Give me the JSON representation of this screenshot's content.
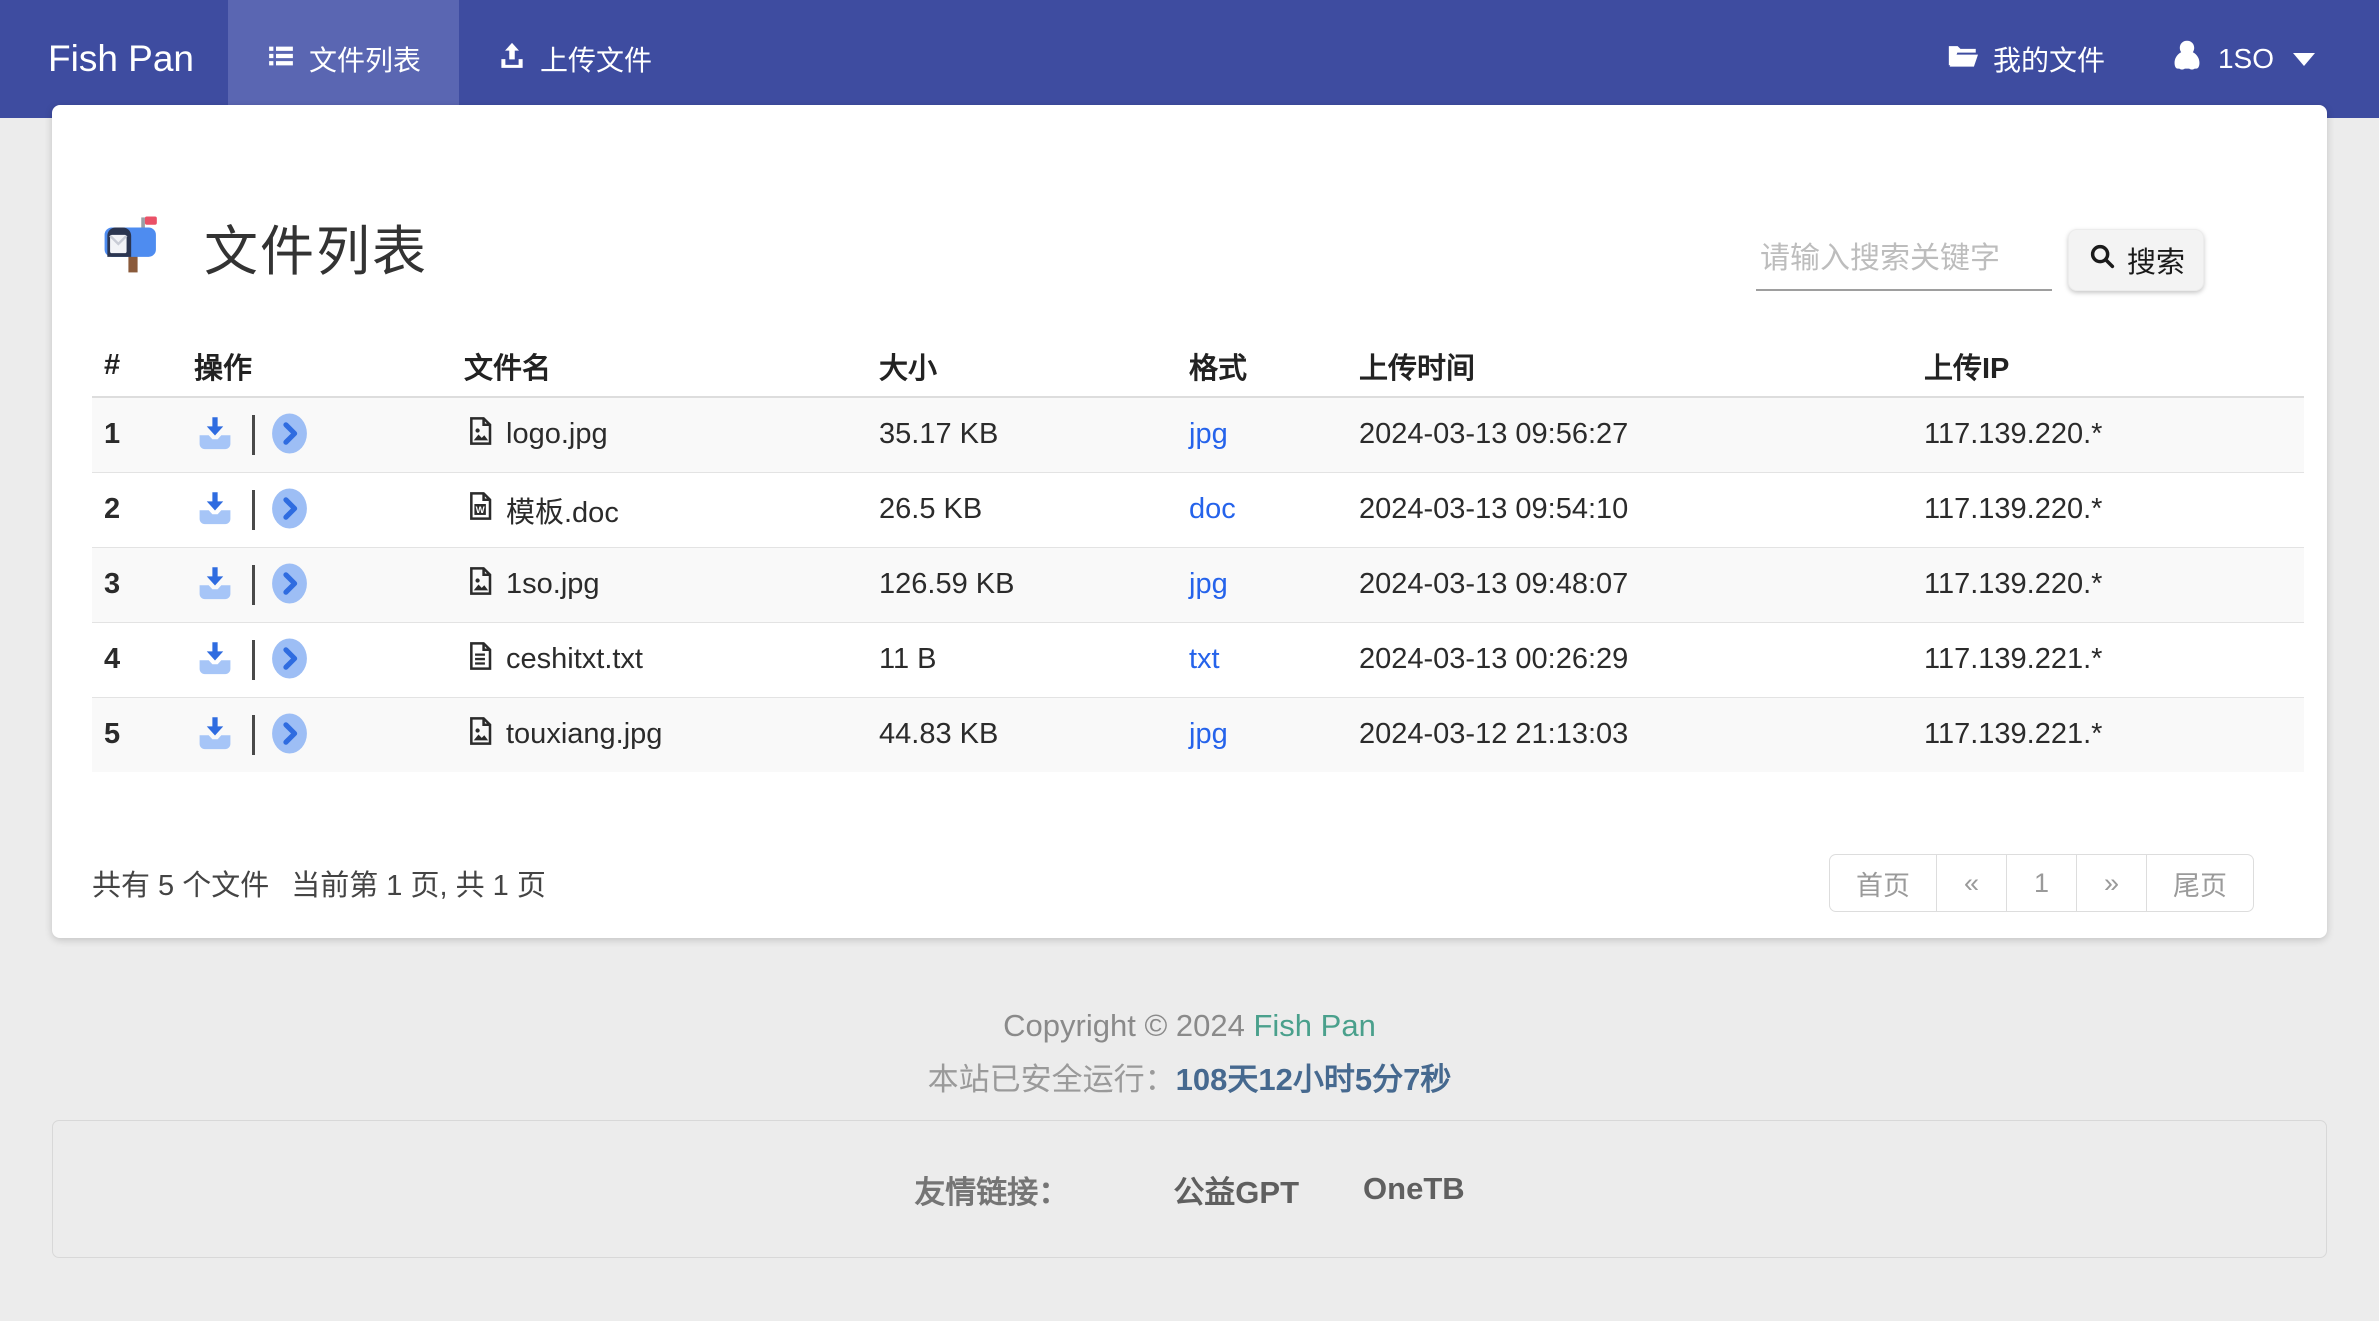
{
  "navbar": {
    "brand": "Fish Pan",
    "tabs": [
      {
        "label": "文件列表",
        "icon": "list-icon",
        "active": true
      },
      {
        "label": "上传文件",
        "icon": "upload-icon",
        "active": false
      }
    ],
    "my_files_label": "我的文件",
    "username": "1SO"
  },
  "card": {
    "title": "文件列表",
    "title_icon": "mailbox-icon",
    "search": {
      "placeholder": "请输入搜索关键字",
      "button_label": "搜索",
      "button_icon": "magnifier-icon"
    },
    "table": {
      "columns": [
        "#",
        "操作",
        "文件名",
        "大小",
        "格式",
        "上传时间",
        "上传IP"
      ],
      "action_icons": [
        "download-icon",
        "chevron-right-circle-icon"
      ],
      "rows": [
        {
          "no": "1",
          "icon": "image-file-icon",
          "name": "logo.jpg",
          "size": "35.17 KB",
          "format": "jpg",
          "time": "2024-03-13 09:56:27",
          "ip": "117.139.220.*"
        },
        {
          "no": "2",
          "icon": "word-file-icon",
          "name": "模板.doc",
          "size": "26.5 KB",
          "format": "doc",
          "time": "2024-03-13 09:54:10",
          "ip": "117.139.220.*"
        },
        {
          "no": "3",
          "icon": "image-file-icon",
          "name": "1so.jpg",
          "size": "126.59 KB",
          "format": "jpg",
          "time": "2024-03-13 09:48:07",
          "ip": "117.139.220.*"
        },
        {
          "no": "4",
          "icon": "text-file-icon",
          "name": "ceshitxt.txt",
          "size": "11 B",
          "format": "txt",
          "time": "2024-03-13 00:26:29",
          "ip": "117.139.221.*"
        },
        {
          "no": "5",
          "icon": "image-file-icon",
          "name": "touxiang.jpg",
          "size": "44.83 KB",
          "format": "jpg",
          "time": "2024-03-12 21:13:03",
          "ip": "117.139.221.*"
        }
      ]
    },
    "summary_count": "共有 5 个文件",
    "summary_page": "当前第 1 页, 共 1 页",
    "pagination": [
      {
        "label": "首页",
        "name": "first-page-button"
      },
      {
        "label": "«",
        "name": "prev-page-button"
      },
      {
        "label": "1",
        "name": "page-1-button"
      },
      {
        "label": "»",
        "name": "next-page-button"
      },
      {
        "label": "尾页",
        "name": "last-page-button"
      }
    ]
  },
  "footer": {
    "copyright_prefix": "Copyright © 2024 ",
    "brand_link": "Fish Pan",
    "uptime_label": "本站已安全运行：",
    "uptime_value": "108天12小时5分7秒",
    "links_label": "友情链接：",
    "links": [
      {
        "label": "公益GPT"
      },
      {
        "label": "OneTB"
      }
    ]
  },
  "colors": {
    "navbar": "#3e4ca0",
    "navbar_active_tab": "#5a66b2",
    "accent_blue": "#2f6ce0",
    "accent_blue_light": "#9dbef5",
    "format_link": "#2563eb",
    "brand_link_teal": "#4aa08c",
    "uptime_blue": "#46698f",
    "stripe": "#f9f9f9",
    "page_bg": "#ececec"
  }
}
